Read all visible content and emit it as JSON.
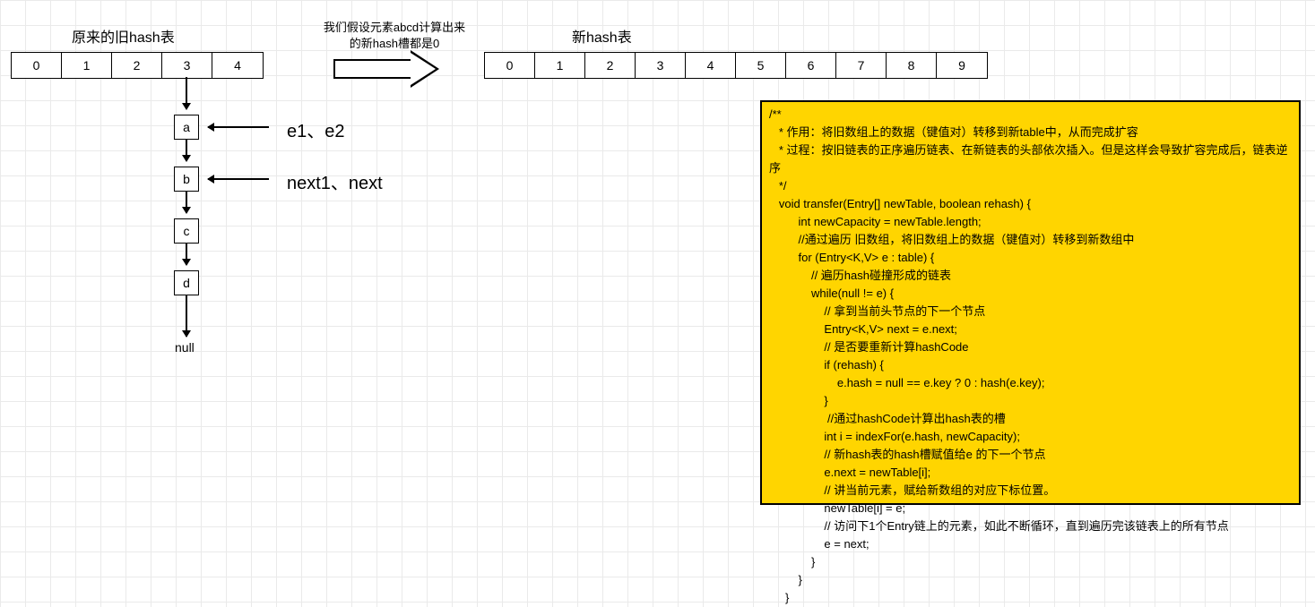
{
  "titles": {
    "old": "原来的旧hash表",
    "new": "新hash表",
    "note_l1": "我们假设元素abcd计算出来",
    "note_l2": "的新hash槽都是0"
  },
  "old_table": [
    "0",
    "1",
    "2",
    "3",
    "4"
  ],
  "new_table": [
    "0",
    "1",
    "2",
    "3",
    "4",
    "5",
    "6",
    "7",
    "8",
    "9"
  ],
  "nodes": {
    "a": "a",
    "b": "b",
    "c": "c",
    "d": "d",
    "null": "null"
  },
  "ptr_a": "e1、e2",
  "ptr_b": "next1、next",
  "code": "/**\n   * 作用：将旧数组上的数据（键值对）转移到新table中，从而完成扩容\n   * 过程：按旧链表的正序遍历链表、在新链表的头部依次插入。但是这样会导致扩容完成后，链表逆\n序\n   */\n   void transfer(Entry[] newTable, boolean rehash) {\n         int newCapacity = newTable.length;\n         //通过遍历 旧数组，将旧数组上的数据（键值对）转移到新数组中\n         for (Entry<K,V> e : table) {\n             // 遍历hash碰撞形成的链表\n             while(null != e) {\n                 // 拿到当前头节点的下一个节点\n                 Entry<K,V> next = e.next;\n                 // 是否要重新计算hashCode\n                 if (rehash) {\n                     e.hash = null == e.key ? 0 : hash(e.key);\n                 }\n                  //通过hashCode计算出hash表的槽\n                 int i = indexFor(e.hash, newCapacity);\n                 // 新hash表的hash槽赋值给e 的下一个节点\n                 e.next = newTable[i];\n                 // 讲当前元素，赋给新数组的对应下标位置。\n                 newTable[i] = e;\n                 // 访问下1个Entry链上的元素，如此不断循环，直到遍历完该链表上的所有节点\n                 e = next;\n             }\n         }\n     }"
}
